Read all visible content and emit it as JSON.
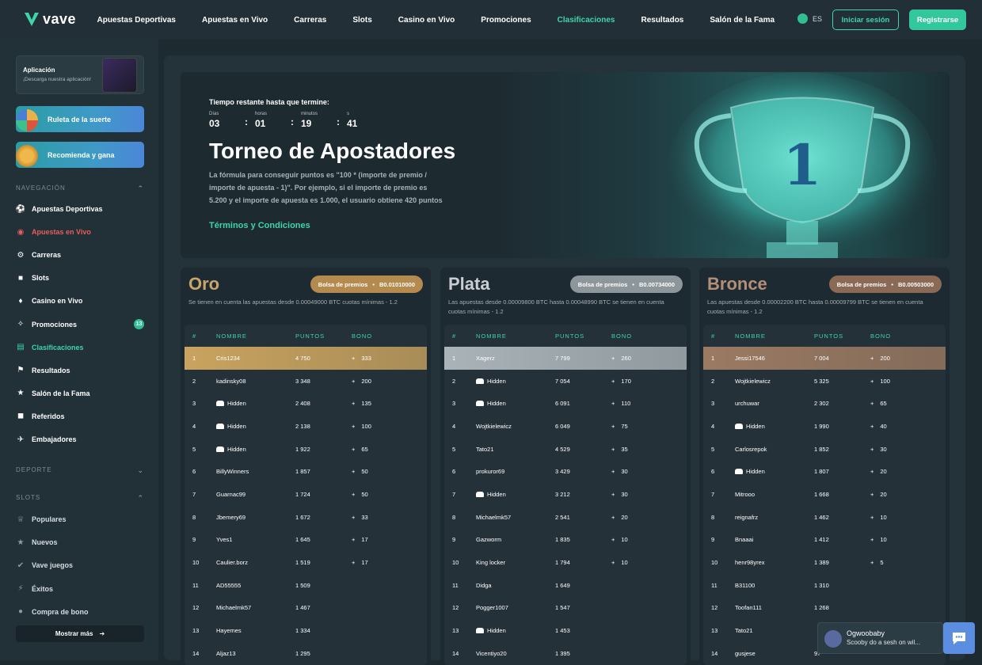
{
  "header": {
    "logo_text": "vave",
    "nav": [
      "Apuestas Deportivas",
      "Apuestas en Vivo",
      "Carreras",
      "Slots",
      "Casino en Vivo",
      "Promociones",
      "Clasificaciones",
      "Resultados",
      "Salón de la Fama"
    ],
    "active_nav": "Clasificaciones",
    "lang": "ES",
    "login": "Iniciar sesión",
    "register": "Registrarse"
  },
  "sidebar": {
    "app_title": "Aplicación",
    "app_sub": "¡Descarga nuestra aplicación!",
    "promo1": "Ruleta de la suerte",
    "promo2": "Recomienda y gana",
    "nav_header": "NAVEGACIÓN",
    "nav_items": [
      "Apuestas Deportivas",
      "Apuestas en Vivo",
      "Carreras",
      "Slots",
      "Casino en Vivo",
      "Promociones",
      "Clasificaciones",
      "Resultados",
      "Salón de la Fama",
      "Referidos",
      "Embajadores"
    ],
    "promo_badge": "13",
    "deporte_header": "DEPORTE",
    "slots_header": "SLOTS",
    "slot_items": [
      "Populares",
      "Nuevos",
      "Vave juegos",
      "Éxitos",
      "Compra de bono"
    ],
    "show_more": "Mostrar más"
  },
  "hero": {
    "timer_label": "Tiempo restante hasta que termine:",
    "units": [
      "Días",
      "horas",
      "minutos",
      "s"
    ],
    "values": [
      "03",
      "01",
      "19",
      "41"
    ],
    "title": "Torneo de Apostadores",
    "description": "La fórmula para conseguir puntos es \"100 * (importe de premio / importe de apuesta - 1)\". Por ejemplo, si el importe de premio es 5.200 y el importe de apuesta es 1.000, el usuario obtiene 420 puntos",
    "terms": "Términos y Condiciones"
  },
  "columns": [
    "#",
    "NOMBRE",
    "PUNTOS",
    "BONO"
  ],
  "boards": [
    {
      "title": "Oro",
      "title_color": "#c9a56a",
      "pool_label": "Bolsa de premios",
      "pool_value": "B0.01010000",
      "pool_color": "#b48a4f",
      "desc": "Se tienen en cuenta las apuestas desde 0.00049000 BTC cuotas mínimas - 1.2",
      "highlight": "#c9a35f",
      "rows": [
        [
          "1",
          "Cris1234",
          "4 750",
          "+",
          "333"
        ],
        [
          "2",
          "kadinsky08",
          "3 348",
          "+",
          "200"
        ],
        [
          "3",
          "Hidden",
          "2 408",
          "+",
          "135"
        ],
        [
          "4",
          "Hidden",
          "2 138",
          "+",
          "100"
        ],
        [
          "5",
          "Hidden",
          "1 922",
          "+",
          "65"
        ],
        [
          "6",
          "BillyWinners",
          "1 857",
          "+",
          "50"
        ],
        [
          "7",
          "Guarnac99",
          "1 724",
          "+",
          "50"
        ],
        [
          "8",
          "Jbemery69",
          "1 672",
          "+",
          "33"
        ],
        [
          "9",
          "Yves1",
          "1 645",
          "+",
          "17"
        ],
        [
          "10",
          "Caulier.borz",
          "1 519",
          "+",
          "17"
        ],
        [
          "11",
          "AD55555",
          "1 509",
          "",
          ""
        ],
        [
          "12",
          "Michaelmk57",
          "1 467",
          "",
          ""
        ],
        [
          "13",
          "Hayemes",
          "1 334",
          "",
          ""
        ],
        [
          "14",
          "Aljaz13",
          "1 295",
          "",
          ""
        ]
      ]
    },
    {
      "title": "Plata",
      "title_color": "#c8ced1",
      "pool_label": "Bolsa de premios",
      "pool_value": "B0.00734000",
      "pool_color": "#8d979b",
      "desc": "Las apuestas desde 0.00009800 BTC hasta 0.00048990 BTC se tienen en cuenta cuotas mínimas - 1.2",
      "highlight": "#aab3b7",
      "rows": [
        [
          "1",
          "Xagerz",
          "7 799",
          "+",
          "260"
        ],
        [
          "2",
          "Hidden",
          "7 054",
          "+",
          "170"
        ],
        [
          "3",
          "Hidden",
          "6 091",
          "+",
          "110"
        ],
        [
          "4",
          "Wojtkielewicz",
          "6 049",
          "+",
          "75"
        ],
        [
          "5",
          "Tato21",
          "4 529",
          "+",
          "35"
        ],
        [
          "6",
          "prokuror69",
          "3 429",
          "+",
          "30"
        ],
        [
          "7",
          "Hidden",
          "3 212",
          "+",
          "30"
        ],
        [
          "8",
          "Michaelmk57",
          "2 541",
          "+",
          "20"
        ],
        [
          "9",
          "Gazworm",
          "1 835",
          "+",
          "10"
        ],
        [
          "10",
          "King locker",
          "1 794",
          "+",
          "10"
        ],
        [
          "11",
          "Didga",
          "1 649",
          "",
          ""
        ],
        [
          "12",
          "Pogger1007",
          "1 547",
          "",
          ""
        ],
        [
          "13",
          "Hidden",
          "1 453",
          "",
          ""
        ],
        [
          "14",
          "Vicentiyo20",
          "1 395",
          "",
          ""
        ]
      ]
    },
    {
      "title": "Bronce",
      "title_color": "#b38f78",
      "pool_label": "Bolsa de premios",
      "pool_value": "B0.00503000",
      "pool_color": "#8a6a55",
      "desc": "Las apuestas desde 0.00002200 BTC hasta 0.00009799 BTC se tienen en cuenta cuotas mínimas - 1.2",
      "highlight": "#9b7a62",
      "rows": [
        [
          "1",
          "Jessi17546",
          "7 004",
          "+",
          "200"
        ],
        [
          "2",
          "Wojtkielewicz",
          "5 325",
          "+",
          "100"
        ],
        [
          "3",
          "urchuwar",
          "2 302",
          "+",
          "65"
        ],
        [
          "4",
          "Hidden",
          "1 990",
          "+",
          "40"
        ],
        [
          "5",
          "Carlosrepok",
          "1 852",
          "+",
          "30"
        ],
        [
          "6",
          "Hidden",
          "1 807",
          "+",
          "20"
        ],
        [
          "7",
          "Mitrooo",
          "1 668",
          "+",
          "20"
        ],
        [
          "8",
          "reignafrz",
          "1 462",
          "+",
          "10"
        ],
        [
          "9",
          "Bnaaai",
          "1 412",
          "+",
          "10"
        ],
        [
          "10",
          "henr98yrex",
          "1 389",
          "+",
          "5"
        ],
        [
          "11",
          "B31100",
          "1 310",
          "",
          ""
        ],
        [
          "12",
          "Toofan111",
          "1 268",
          "",
          ""
        ],
        [
          "13",
          "Tato21",
          "",
          "",
          ""
        ],
        [
          "14",
          "gusjese",
          "97",
          "",
          ""
        ]
      ]
    }
  ],
  "chat": {
    "name": "Ogwoobaby",
    "message": "Scooby do a sesh on wil..."
  }
}
